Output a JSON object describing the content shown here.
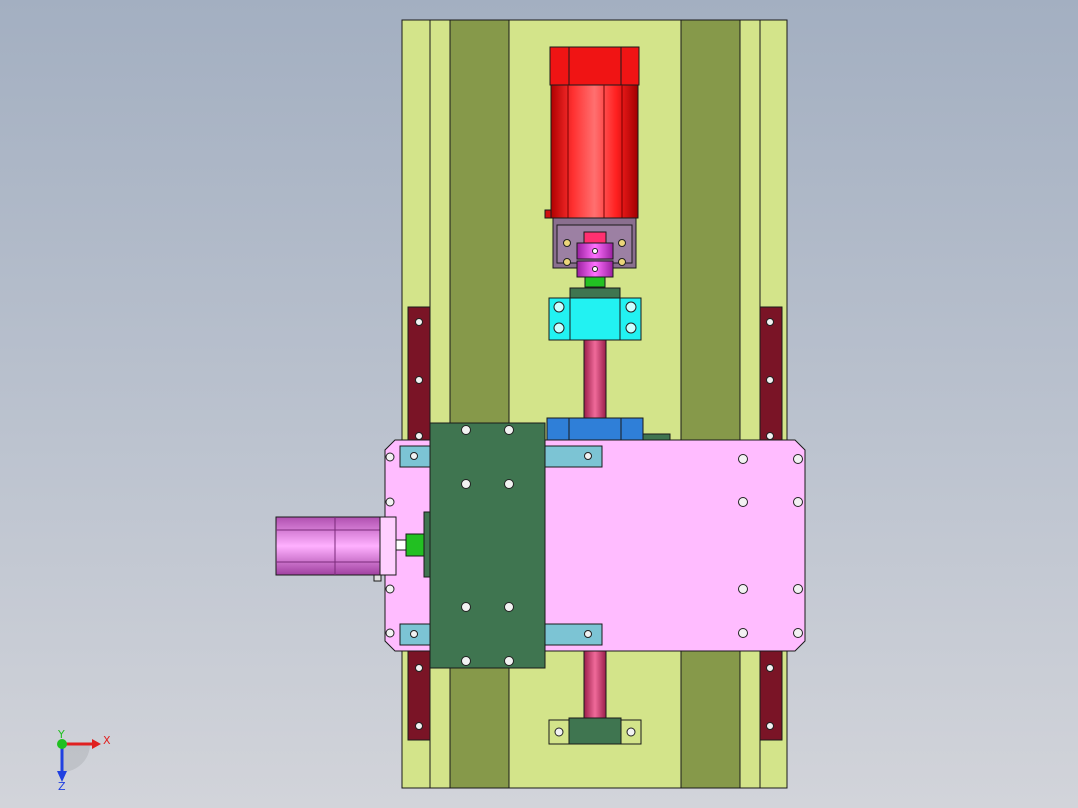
{
  "viewport": {
    "background_top": "#a3afc1",
    "background_bottom": "#d2d4da"
  },
  "model": {
    "colors": {
      "base_plate": "#d3e48a",
      "guide_rail": "#86994a",
      "servo_motor": "#ff1a1a",
      "motor_flange": "#8a6f8f",
      "coupling": "#e040e0",
      "bearing_block": "#22f2f2",
      "ball_screw": "#d8457a",
      "screw_nut": "#2f7fd8",
      "carriage_plate": "#ffbcff",
      "carriage_block": "#3f7550",
      "slide_block": "#7cc4d4",
      "side_stop": "#7a1426",
      "side_motor": "#ee8cee",
      "bolt": "#f2f2f2"
    }
  },
  "triad": {
    "x_label": "X",
    "y_label": "Y",
    "z_label": "Z",
    "x_color": "#e02020",
    "y_color": "#20c020",
    "z_color": "#2040e0"
  }
}
